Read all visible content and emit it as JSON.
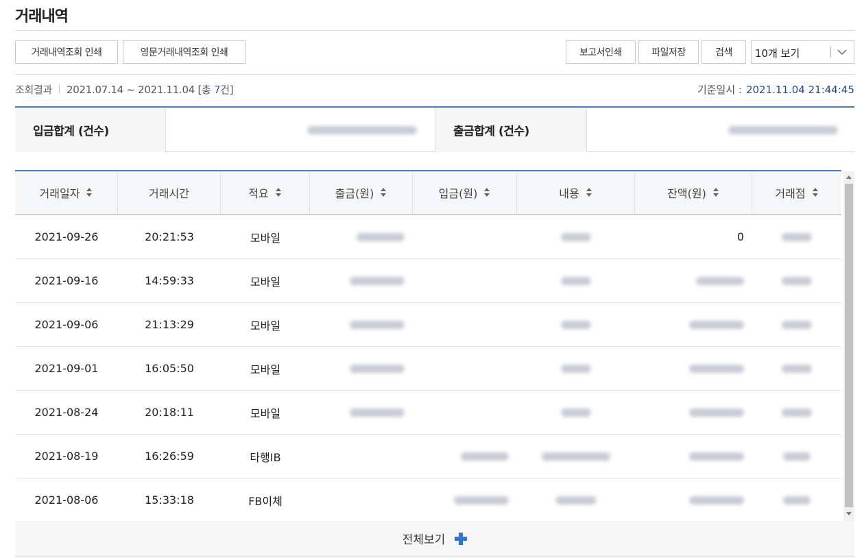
{
  "page": {
    "title": "거래내역"
  },
  "toolbar": {
    "print_label": "거래내역조회 인쇄",
    "print_en_label": "영문거래내역조회 인쇄",
    "report_print_label": "보고서인쇄",
    "file_save_label": "파일저장",
    "search_label": "검색",
    "page_size": {
      "selected": "10개 보기"
    }
  },
  "result": {
    "label": "조회결과",
    "range": "2021.07.14 ~ 2021.11.04",
    "count_prefix": "[총 ",
    "count": "7",
    "count_suffix": "건]",
    "basis_label": "기준일시 :",
    "basis_time": "2021.11.04 21:44:45"
  },
  "summary": {
    "deposit_label": "입금합계 (건수)",
    "withdrawal_label": "출금합계 (건수)"
  },
  "table": {
    "columns": [
      "거래일자",
      "거래시간",
      "적요",
      "출금(원)",
      "입금(원)",
      "내용",
      "잔액(원)",
      "거래점"
    ],
    "rows": [
      {
        "date": "2021-09-26",
        "time": "20:21:53",
        "memo": "모바일",
        "balance": "0"
      },
      {
        "date": "2021-09-16",
        "time": "14:59:33",
        "memo": "모바일",
        "balance": ""
      },
      {
        "date": "2021-09-06",
        "time": "21:13:29",
        "memo": "모바일",
        "balance": ""
      },
      {
        "date": "2021-09-01",
        "time": "16:05:50",
        "memo": "모바일",
        "balance": ""
      },
      {
        "date": "2021-08-24",
        "time": "20:18:11",
        "memo": "모바일",
        "balance": ""
      },
      {
        "date": "2021-08-19",
        "time": "16:26:59",
        "memo": "타행IB",
        "balance": ""
      },
      {
        "date": "2021-08-06",
        "time": "15:33:18",
        "memo": "FB이체",
        "balance": ""
      }
    ]
  },
  "footer": {
    "view_all_label": "전체보기"
  },
  "colors": {
    "accent": "#4a7cc4",
    "plus": "#2f74d0"
  }
}
